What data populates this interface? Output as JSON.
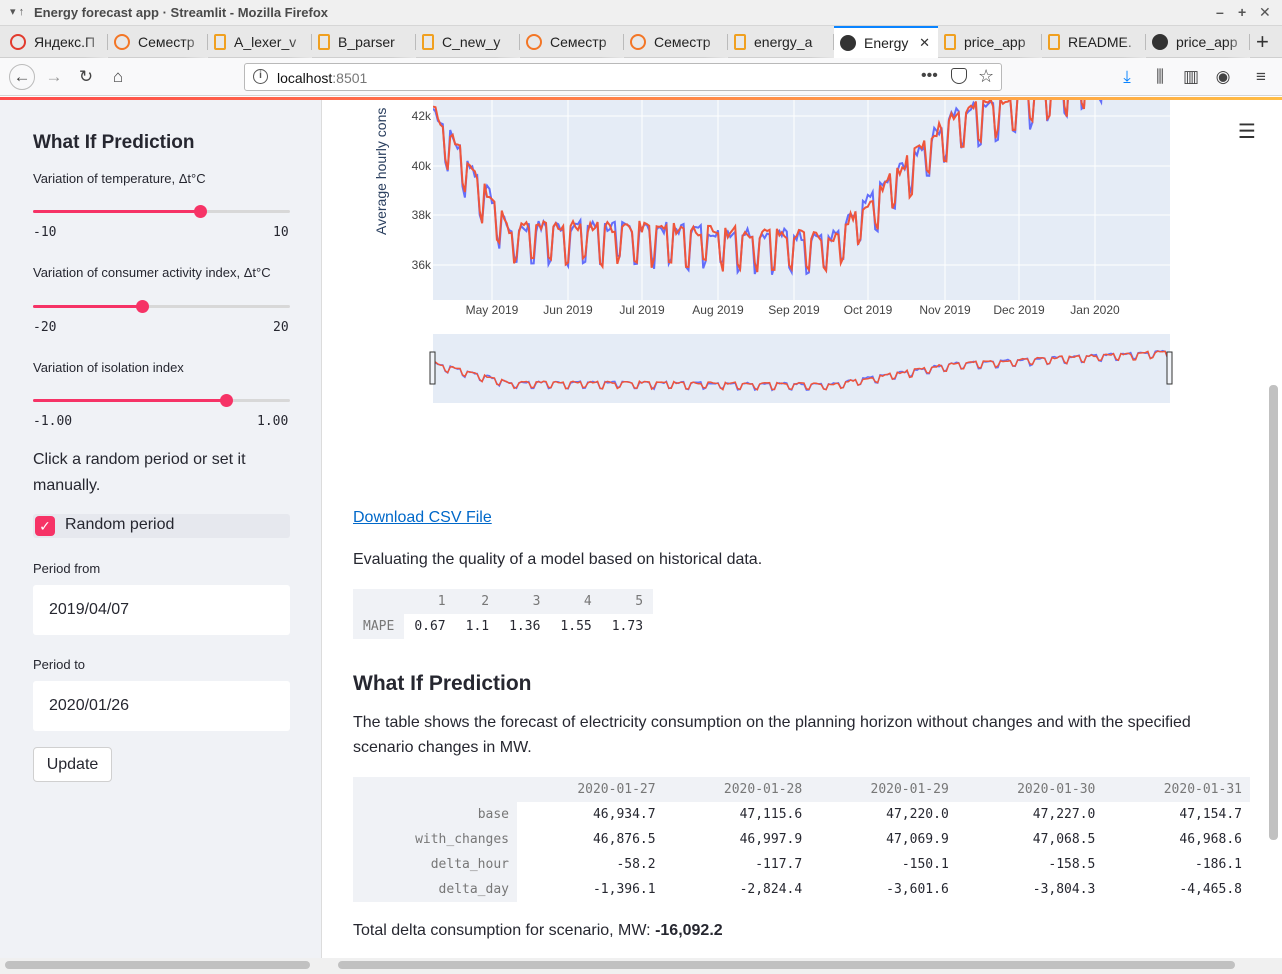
{
  "window": {
    "title": "Energy forecast app · Streamlit - Mozilla Firefox"
  },
  "tabs": [
    {
      "label": "Яндекс.П",
      "icon": "yandex-icon"
    },
    {
      "label": "Семестр",
      "icon": "jupyter-icon"
    },
    {
      "label": "A_lexer_v",
      "icon": "notebook-icon"
    },
    {
      "label": "B_parser",
      "icon": "notebook-icon"
    },
    {
      "label": "C_new_y",
      "icon": "notebook-icon"
    },
    {
      "label": "Семестр",
      "icon": "jupyter-icon"
    },
    {
      "label": "Семестр",
      "icon": "jupyter-icon"
    },
    {
      "label": "energy_a",
      "icon": "file-icon"
    },
    {
      "label": "Energy",
      "icon": "streamlit-icon",
      "active": true
    },
    {
      "label": "price_app",
      "icon": "file-icon"
    },
    {
      "label": "README.",
      "icon": "file-icon"
    },
    {
      "label": "price_app",
      "icon": "streamlit-icon"
    }
  ],
  "address": {
    "host": "localhost",
    "port": ":8501"
  },
  "sidebar": {
    "heading": "What If Prediction",
    "sliders": [
      {
        "label": "Variation of temperature, Δt°C",
        "min": "-10",
        "max": "10",
        "fraction": 0.65
      },
      {
        "label": "Variation of consumer activity index, Δt°C",
        "min": "-20",
        "max": "20",
        "fraction": 0.42
      },
      {
        "label": "Variation of isolation index",
        "min": "-1.00",
        "max": "1.00",
        "fraction": 0.75
      }
    ],
    "period_prompt": "Click a random period or set it manually.",
    "random_period_label": "Random period",
    "random_period_checked": true,
    "period_from_label": "Period from",
    "period_from_value": "2019/04/07",
    "period_to_label": "Period to",
    "period_to_value": "2020/01/26",
    "update_label": "Update"
  },
  "chart_data": {
    "type": "line",
    "ylabel": "Average hourly cons",
    "y_ticks": [
      "42k",
      "40k",
      "38k",
      "36k"
    ],
    "x_ticks": [
      "May 2019",
      "Jun 2019",
      "Jul 2019",
      "Aug 2019",
      "Sep 2019",
      "Oct 2019",
      "Nov 2019",
      "Dec 2019",
      "Jan 2020"
    ],
    "colors": {
      "actual": "#636efa",
      "forecast": "#ef553b",
      "plot_bg": "#e5ecf6"
    },
    "range_slider": true
  },
  "main": {
    "download_link": "Download CSV File",
    "quality_text": "Evaluating the quality of a model based on historical data.",
    "mape_table": {
      "columns": [
        "1",
        "2",
        "3",
        "4",
        "5"
      ],
      "row_label": "MAPE",
      "values": [
        "0.67",
        "1.1",
        "1.36",
        "1.55",
        "1.73"
      ]
    },
    "whatif_heading": "What If Prediction",
    "whatif_text": "The table shows the forecast of electricity consumption on the planning horizon without changes and with the specified scenario changes in MW.",
    "whatif_table": {
      "columns": [
        "2020-01-27",
        "2020-01-28",
        "2020-01-29",
        "2020-01-30",
        "2020-01-31"
      ],
      "rows": [
        {
          "label": "base",
          "values": [
            "46,934.7",
            "47,115.6",
            "47,220.0",
            "47,227.0",
            "47,154.7"
          ]
        },
        {
          "label": "with_changes",
          "values": [
            "46,876.5",
            "46,997.9",
            "47,069.9",
            "47,068.5",
            "46,968.6"
          ]
        },
        {
          "label": "delta_hour",
          "values": [
            "-58.2",
            "-117.7",
            "-150.1",
            "-158.5",
            "-186.1"
          ]
        },
        {
          "label": "delta_day",
          "values": [
            "-1,396.1",
            "-2,824.4",
            "-3,601.6",
            "-3,804.3",
            "-4,465.8"
          ]
        }
      ]
    },
    "total_label": "Total delta consumption for scenario, MW: ",
    "total_value": "-16,092.2"
  }
}
